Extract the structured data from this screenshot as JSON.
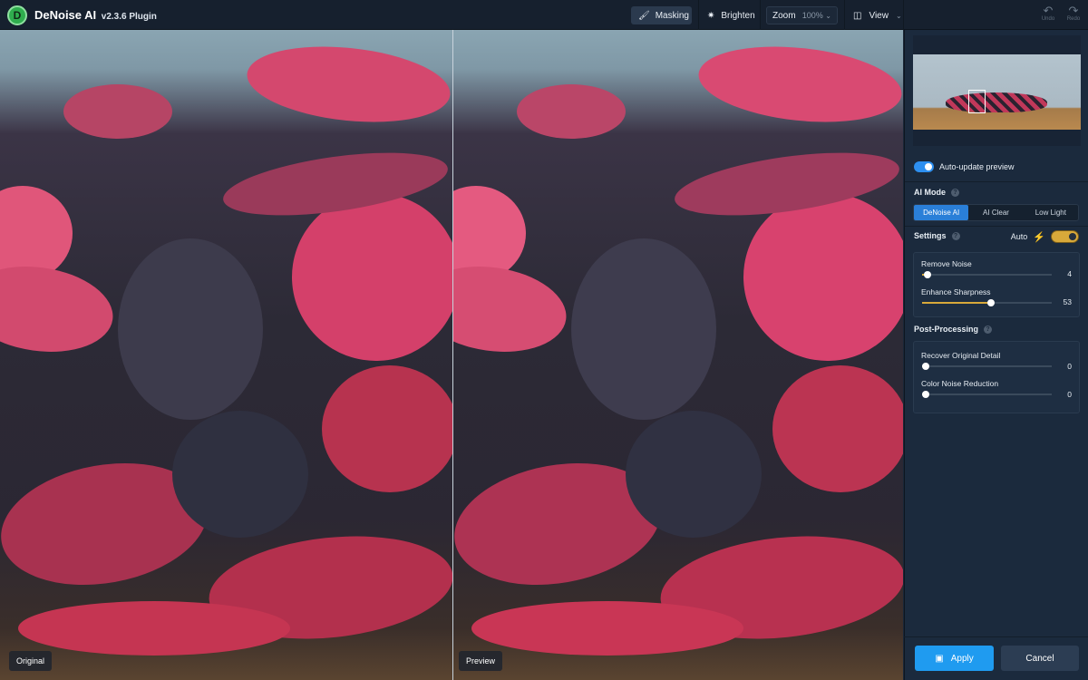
{
  "app": {
    "name": "DeNoise AI",
    "version": "v2.3.6 Plugin",
    "logo_letter": "D"
  },
  "toolbar": {
    "masking_label": "Masking",
    "brighten_label": "Brighten",
    "zoom_label": "Zoom",
    "zoom_value": "100%",
    "view_label": "View",
    "undo_label": "Undo",
    "redo_label": "Redo"
  },
  "panes": {
    "left_label": "Original",
    "right_label": "Preview"
  },
  "panel": {
    "auto_update_label": "Auto-update preview",
    "auto_update_on": true,
    "ai_mode_title": "AI Mode",
    "ai_modes": [
      "DeNoise AI",
      "AI Clear",
      "Low Light"
    ],
    "ai_mode_selected": "DeNoise AI",
    "settings_title": "Settings",
    "auto_label": "Auto",
    "settings": [
      {
        "label": "Remove Noise",
        "value": "4",
        "fraction": 0.04
      },
      {
        "label": "Enhance Sharpness",
        "value": "53",
        "fraction": 0.53
      }
    ],
    "post_title": "Post-Processing",
    "post": [
      {
        "label": "Recover Original Detail",
        "value": "0",
        "fraction": 0.0
      },
      {
        "label": "Color Noise Reduction",
        "value": "0",
        "fraction": 0.0
      }
    ],
    "apply_label": "Apply",
    "cancel_label": "Cancel"
  },
  "colors": {
    "accent": "#2a7fd8",
    "apply": "#1f9bf0",
    "slider_fill": "#d8a93a"
  }
}
